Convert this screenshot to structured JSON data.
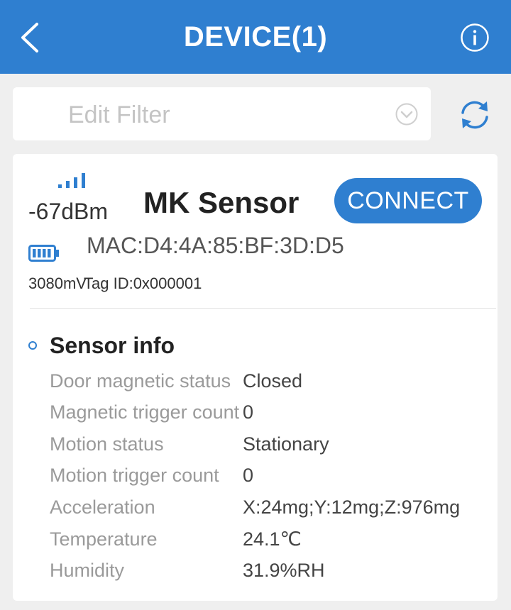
{
  "header": {
    "title": "DEVICE(1)"
  },
  "filter": {
    "placeholder": "Edit Filter",
    "value": ""
  },
  "device": {
    "rssi": "-67dBm",
    "name": "MK Sensor",
    "connect_label": "CONNECT",
    "mac": "MAC:D4:4A:85:BF:3D:D5",
    "voltage": "3080mV",
    "tag_id": "Tag ID:0x000001"
  },
  "sensor_info": {
    "title": "Sensor info",
    "rows": [
      {
        "label": "Door magnetic status",
        "value": "Closed"
      },
      {
        "label": "Magnetic trigger count",
        "value": "0"
      },
      {
        "label": "Motion status",
        "value": "Stationary"
      },
      {
        "label": "Motion trigger count",
        "value": "0"
      },
      {
        "label": "Acceleration",
        "value": "X:24mg;Y:12mg;Z:976mg"
      },
      {
        "label": "Temperature",
        "value": "24.1℃"
      },
      {
        "label": "Humidity",
        "value": "31.9%RH"
      }
    ]
  },
  "colors": {
    "primary": "#2f7fd0",
    "background": "#efefef",
    "card": "#ffffff"
  },
  "icons": [
    "back-arrow-icon",
    "info-icon",
    "search-icon",
    "chevron-down-icon",
    "refresh-icon",
    "signal-icon",
    "battery-icon"
  ]
}
